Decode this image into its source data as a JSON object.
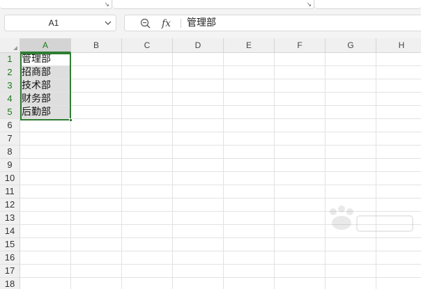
{
  "namebox": {
    "value": "A1",
    "arrow_icon": "chevron-down-icon"
  },
  "formula_bar": {
    "zoom_icon": "zoom-icon",
    "fx_label": "fx",
    "content": "管理部"
  },
  "columns": [
    "A",
    "B",
    "C",
    "D",
    "E",
    "F",
    "G",
    "H"
  ],
  "rows": [
    "1",
    "2",
    "3",
    "4",
    "5",
    "6",
    "7",
    "8",
    "9",
    "10",
    "11",
    "12",
    "13",
    "14",
    "15",
    "16",
    "17",
    "18"
  ],
  "cells": {
    "A1": "管理部",
    "A2": "招商部",
    "A3": "技术部",
    "A4": "财务部",
    "A5": "后勤部"
  },
  "selection": {
    "active_cell": "A1",
    "range": "A1:A5"
  },
  "colors": {
    "selection": "#2e7d32",
    "header_bg": "#f0f0f0"
  }
}
